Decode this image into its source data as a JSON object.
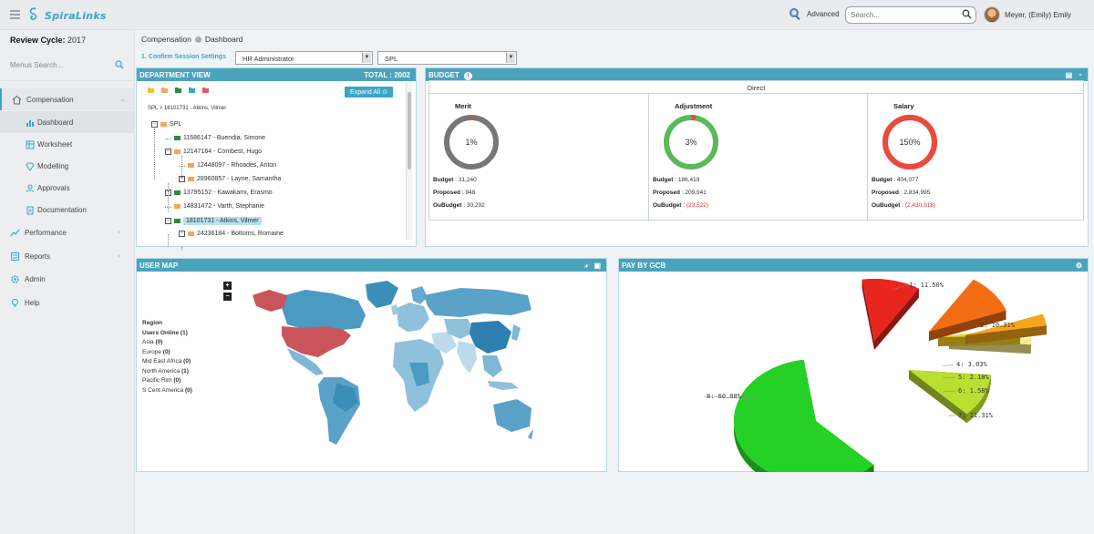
{
  "app": {
    "logo_text": "SpiraLinks",
    "advanced_label": "Advanced",
    "search_placeholder": "Search...",
    "user_name": "Meyer, (Emily) Emily"
  },
  "sidebar": {
    "review_cycle_label": "Review Cycle:",
    "review_cycle_value": "2017",
    "menu_search_placeholder": "Menus Search...",
    "items": [
      {
        "label": "Compensation",
        "icon": "home-icon"
      },
      {
        "label": "Dashboard",
        "icon": "bar-chart-icon"
      },
      {
        "label": "Worksheet",
        "icon": "worksheet-icon"
      },
      {
        "label": "Modelling",
        "icon": "diamond-icon"
      },
      {
        "label": "Approvals",
        "icon": "user-icon"
      },
      {
        "label": "Documentation",
        "icon": "document-icon"
      },
      {
        "label": "Performance",
        "icon": "performance-icon"
      },
      {
        "label": "Reports",
        "icon": "reports-icon"
      },
      {
        "label": "Admin",
        "icon": "gear-icon"
      },
      {
        "label": "Help",
        "icon": "bulb-icon"
      }
    ]
  },
  "breadcrumb": {
    "section": "Compensation",
    "page": "Dashboard"
  },
  "session": {
    "label": "1. Confirm Session Settings",
    "role": "HR Administrator",
    "org": "SPL"
  },
  "department": {
    "title": "DEPARTMENT VIEW",
    "total_label": "TOTAL : 2002",
    "expand_label": "Expand All",
    "path": "SPL > 18101731 - Atkins, Vilmer",
    "folder_colors": [
      "#f2c12e",
      "#f7a35c",
      "#2e8b3e",
      "#3aa6c8",
      "#e8566b"
    ],
    "tree": [
      {
        "label": "SPL",
        "toggle": "−",
        "color": "#f7a35c"
      },
      {
        "label": "11686147 - Buendia, Simone",
        "toggle": "",
        "color": "#2e8b3e"
      },
      {
        "label": "12147164 - Combest, Hugo",
        "toggle": "−",
        "color": "#f7a35c"
      },
      {
        "label": "12448097 - Rhoades, Anton",
        "toggle": "",
        "color": "#f7a35c"
      },
      {
        "label": "28960857 - Layne, Samantha",
        "toggle": "+",
        "color": "#f7a35c"
      },
      {
        "label": "13795152 - Kawakami, Erasmo",
        "toggle": "+",
        "color": "#2e8b3e"
      },
      {
        "label": "14831472 - Varth, Stephanie",
        "toggle": "",
        "color": "#f7a35c"
      },
      {
        "label": "18101731 - Atkins, Vilmer",
        "toggle": "−",
        "color": "#2e8b3e"
      },
      {
        "label": "24236184 - Bottoms, Romaine",
        "toggle": "−",
        "color": "#f7a35c"
      }
    ]
  },
  "budget": {
    "title": "BUDGET",
    "group_title": "Direct",
    "columns": [
      {
        "title": "Merit",
        "percent_label": "1%",
        "percent": 1,
        "ring_color": "#777777",
        "budget": "31,240",
        "proposed": "948",
        "oubudget": "30,292",
        "negative": false
      },
      {
        "title": "Adjustment",
        "percent_label": "3%",
        "percent": 3,
        "ring_color": "#5cb85c",
        "budget": "186,419",
        "proposed": "209,941",
        "oubudget": "(23,522)",
        "negative": true
      },
      {
        "title": "Salary",
        "percent_label": "150%",
        "percent": 150,
        "ring_color": "#f26b6b",
        "budget": "404,077",
        "proposed": "2,834,995",
        "oubudget": "(2,430,918)",
        "negative": true
      }
    ],
    "budget_label": "Budget",
    "proposed_label": "Proposed",
    "oubudget_label": "OuBudget"
  },
  "user_map": {
    "title": "USER MAP",
    "legend_title": "Region",
    "legend_subtitle": "Users Online",
    "legend_total": "(1)",
    "regions": [
      {
        "name": "Asia",
        "count": "(0)"
      },
      {
        "name": "Europe",
        "count": "(0)"
      },
      {
        "name": "Mid East Africa",
        "count": "(0)"
      },
      {
        "name": "North America",
        "count": "(1)"
      },
      {
        "name": "Pacific Rim",
        "count": "(0)"
      },
      {
        "name": "S Cent America",
        "count": "(0)"
      }
    ],
    "zoom_in": "+",
    "zoom_out": "−"
  },
  "pay_by_gcb": {
    "title": "PAY BY GCB",
    "chart_data": {
      "type": "pie",
      "slices": [
        {
          "label": "1: 11.50%",
          "value": 11.5,
          "color": "#e8261e"
        },
        {
          "label": "2: 10.31%",
          "value": 10.31,
          "color": "#f36d14"
        },
        {
          "label": "4: 3.03%",
          "value": 3.03,
          "color": "#f7a51a"
        },
        {
          "label": "5: 2.18%",
          "value": 2.18,
          "color": "#f6d52a"
        },
        {
          "label": "6: 1.58%",
          "value": 1.58,
          "color": "#f9ef8a"
        },
        {
          "label": "7: 11.31%",
          "value": 11.31,
          "color": "#b9e02e"
        },
        {
          "label": "8: 60.08%",
          "value": 60.08,
          "color": "#26d126"
        }
      ]
    }
  }
}
